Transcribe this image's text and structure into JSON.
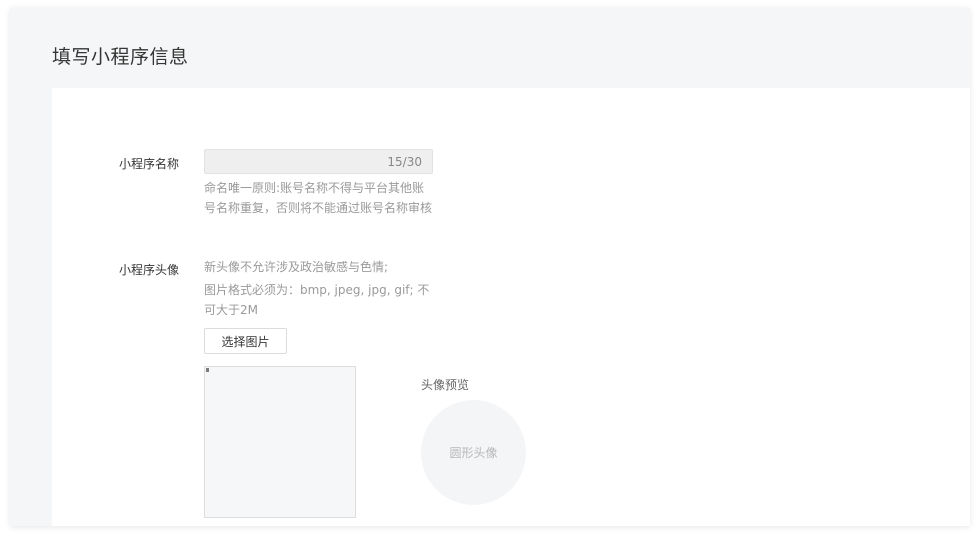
{
  "page": {
    "title": "填写小程序信息"
  },
  "name_field": {
    "label": "小程序名称",
    "value": "",
    "counter": "15/30",
    "tip": "命名唯一原则:账号名称不得与平台其他账号名称重复，否则将不能通过账号名称审核"
  },
  "avatar_field": {
    "label": "小程序头像",
    "tip_line1": "新头像不允许涉及政治敏感与色情;",
    "tip_line2": "图片格式必须为：bmp, jpeg, jpg, gif; 不可大于2M",
    "select_button": "选择图片",
    "preview_title": "头像预览",
    "preview_circle_text": "圆形头像"
  }
}
